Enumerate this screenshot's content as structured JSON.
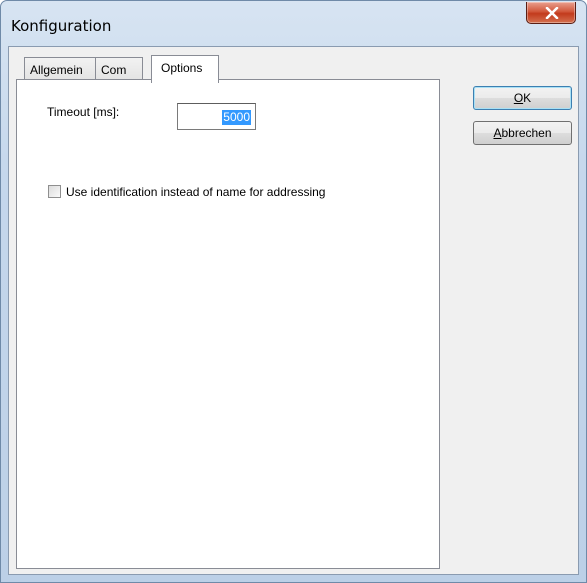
{
  "window": {
    "title": "Konfiguration",
    "close_label": "x"
  },
  "tabs": [
    {
      "label": "Allgemein",
      "active": false
    },
    {
      "label": "Com",
      "active": false
    },
    {
      "label": "Options",
      "active": true
    }
  ],
  "options": {
    "timeout_label": "Timeout [ms]:",
    "timeout_value": "5000",
    "use_identification_label": "Use identification instead of name for addressing",
    "use_identification_checked": false
  },
  "buttons": {
    "ok": {
      "mnemonic": "O",
      "rest": "K"
    },
    "cancel": {
      "mnemonic": "A",
      "rest": "bbrechen"
    }
  },
  "colors": {
    "selection": "#3399ff",
    "close_button": "#c23a1c",
    "frame": "#c5d7ec"
  },
  "icons": {
    "close": "close-x-icon"
  }
}
